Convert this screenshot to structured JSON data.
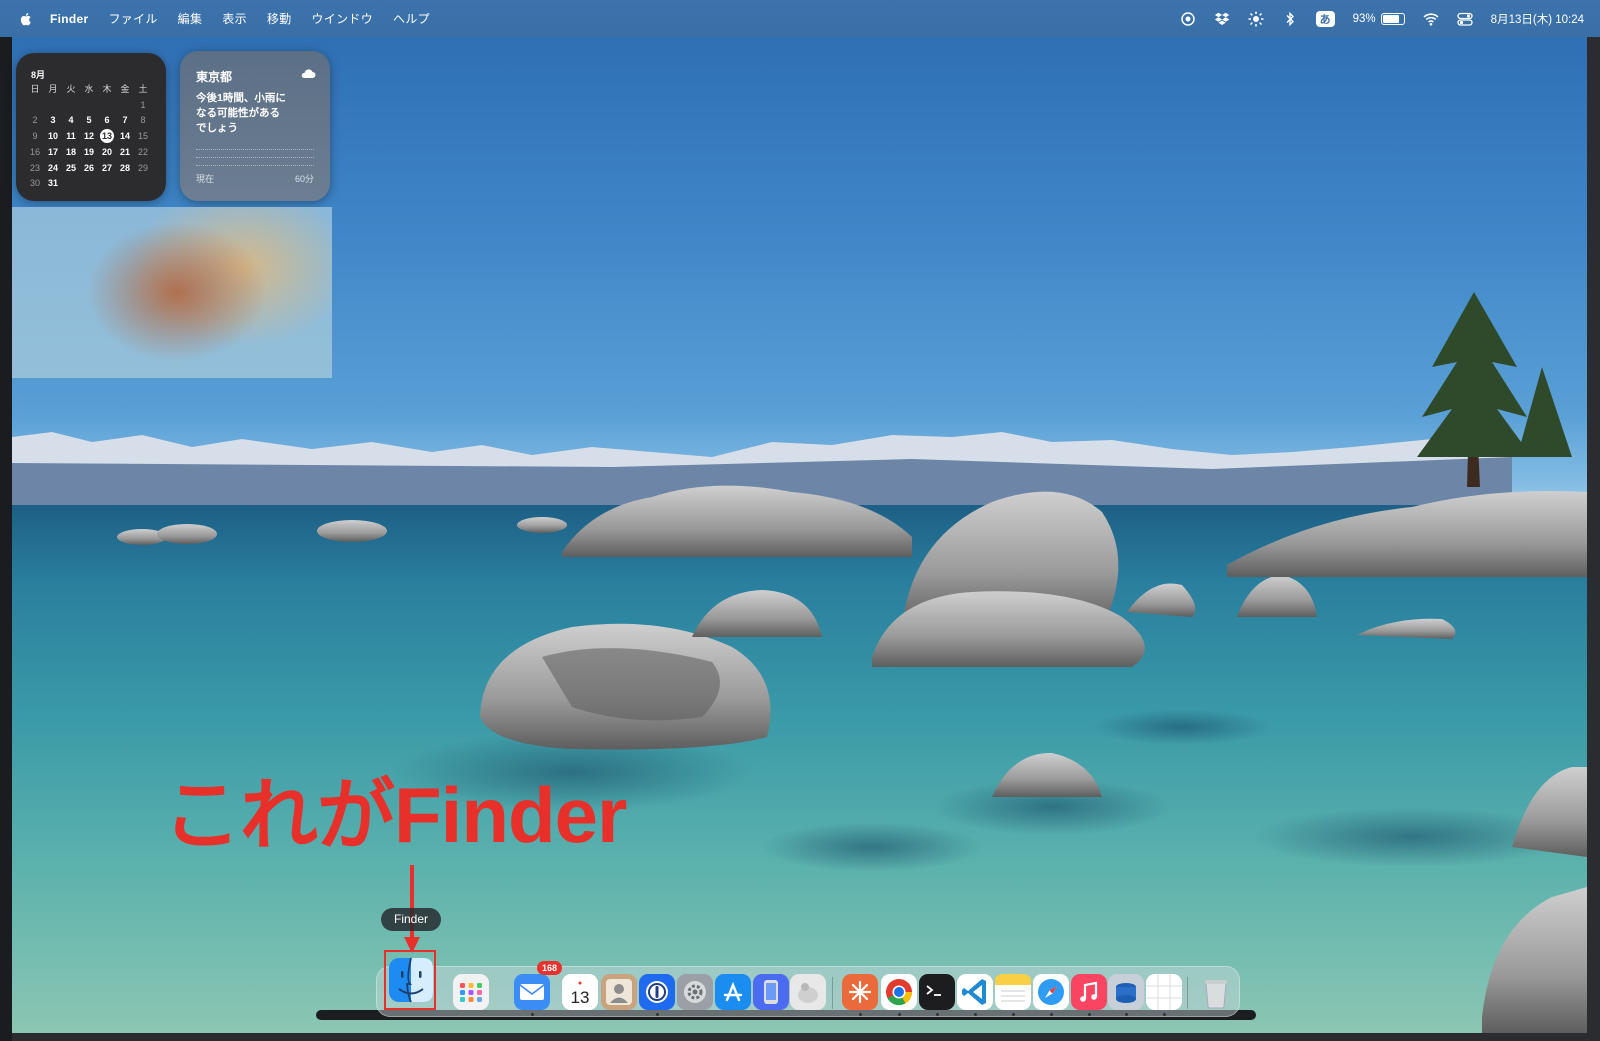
{
  "menubar": {
    "app_name": "Finder",
    "items": [
      "ファイル",
      "編集",
      "表示",
      "移動",
      "ウインドウ",
      "ヘルプ"
    ],
    "ime_label": "あ",
    "battery_percent": "93%",
    "battery_level": 0.93,
    "datetime": "8月13日(木) 10:24"
  },
  "calendar_widget": {
    "month": "8月",
    "weekdays": [
      "日",
      "月",
      "火",
      "水",
      "木",
      "金",
      "土"
    ],
    "weeks": [
      [
        "",
        "",
        "",
        "",
        "",
        "",
        "1"
      ],
      [
        "2",
        "3",
        "4",
        "5",
        "6",
        "7",
        "8"
      ],
      [
        "9",
        "10",
        "11",
        "12",
        "13",
        "14",
        "15"
      ],
      [
        "16",
        "17",
        "18",
        "19",
        "20",
        "21",
        "22"
      ],
      [
        "23",
        "24",
        "25",
        "26",
        "27",
        "28",
        "29"
      ],
      [
        "30",
        "31",
        "",
        "",
        "",
        "",
        ""
      ]
    ],
    "today": "13"
  },
  "weather_widget": {
    "location": "東京都",
    "forecast_lines": [
      "今後1時間、小雨に",
      "なる可能性がある",
      "でしょう"
    ],
    "start_label": "現在",
    "end_label": "60分"
  },
  "annotation": {
    "text": "これがFinder"
  },
  "dock": {
    "tooltip": "Finder",
    "mail_badge": "168",
    "calendar_day": "13",
    "apps": [
      {
        "name": "Finder",
        "icon": "finder-icon"
      },
      {
        "name": "Launchpad",
        "icon": "launchpad-icon"
      },
      {
        "name": "Mail",
        "icon": "mail-icon"
      },
      {
        "name": "Calendar",
        "icon": "calendar-icon"
      },
      {
        "name": "Contacts",
        "icon": "contacts-icon"
      },
      {
        "name": "1Password",
        "icon": "password-icon"
      },
      {
        "name": "System Preferences",
        "icon": "gear-icon"
      },
      {
        "name": "App Store",
        "icon": "app-store-icon"
      },
      {
        "name": "Simulator",
        "icon": "simulator-icon"
      },
      {
        "name": "Preview",
        "icon": "preview-icon"
      },
      {
        "name": "Claude",
        "icon": "claude-icon"
      },
      {
        "name": "Chrome",
        "icon": "chrome-icon"
      },
      {
        "name": "Terminal",
        "icon": "terminal-icon"
      },
      {
        "name": "VS Code",
        "icon": "vscode-icon"
      },
      {
        "name": "Notes",
        "icon": "notes-icon"
      },
      {
        "name": "Safari",
        "icon": "safari-icon"
      },
      {
        "name": "Music",
        "icon": "music-icon"
      },
      {
        "name": "Disk Utility",
        "icon": "disk-utility-icon"
      },
      {
        "name": "Freeform",
        "icon": "freeform-icon"
      },
      {
        "name": "Trash",
        "icon": "trash-icon"
      }
    ]
  },
  "colors": {
    "annotation_red": "#e8302a",
    "menubar_blue": "#3a6fa6",
    "badge_red": "#e8322e"
  }
}
